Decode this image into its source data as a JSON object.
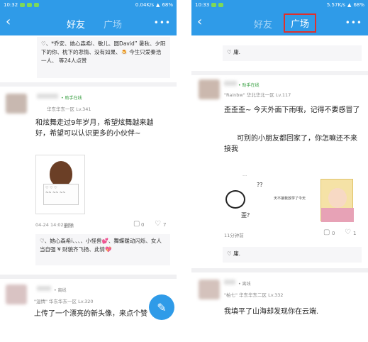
{
  "left_phone": {
    "status": {
      "time": "10:32",
      "speed": "0.04K/s",
      "battery": "68%"
    },
    "header": {
      "tab_friends": "好友",
      "tab_plaza": "广场",
      "more": "•••"
    },
    "top_like_text": "♡、*乔安、她心森希i、敏儿、圆David” 暑秋、夕阳下的你、枕下的悲情、没有如果、🍮 今生只爱秦浩一人、 等24人点赞",
    "post1": {
      "online": "• 助手在线",
      "meta": "华东华东一区 Lv.341",
      "text": "和炫舞走过9年岁月，希望炫舞越来越好，希望可以认识更多的小伙伴~",
      "time": "04-24 14:02",
      "delete": "删除",
      "comments": "0",
      "likes": "7",
      "like_text": "♡、她心森希i、、、、小怪兽💕、舞蝶暖动闪烁、女人当自强 ¥ 财貌齐飞扬、此情💖"
    },
    "post2": {
      "online": "• 离线",
      "meta": "\"温情\" 华东华东一区 Lv.320",
      "text": "上传了一个漂亮的新头像，来点个赞"
    },
    "fab_icon": "✎"
  },
  "right_phone": {
    "status": {
      "time": "10:33",
      "speed": "5.57K/s",
      "battery": "68%"
    },
    "header": {
      "tab_friends": "好友",
      "tab_plaza": "广场",
      "more": "•••"
    },
    "top_like_text": "♡ 庸.",
    "post1": {
      "online": "• 助手在线",
      "meta": "\"Rainbw\" 华北华北一区 Lv.117",
      "text_line1": "歪歪歪~   今天外面下雨哦，记得不要感冒了",
      "text_line2": "可别的小朋友都回家了，你怎嘛还不来接我",
      "time": "11分钟前",
      "comments": "0",
      "likes": "1",
      "like_text": "♡ 庸.",
      "sticker_text": "歪？",
      "sticker_q": "??",
      "sticker_caption": "天不接我放学了今天"
    },
    "post2": {
      "online": "• 离线",
      "meta": "\"柏七\" 华东华东二区 Lv.332",
      "text": "我填平了山海却发现你在云端."
    }
  },
  "colors": {
    "brand_blue": "#2f9be8",
    "highlight_red": "#e0302c",
    "online_green": "#3aa043"
  }
}
